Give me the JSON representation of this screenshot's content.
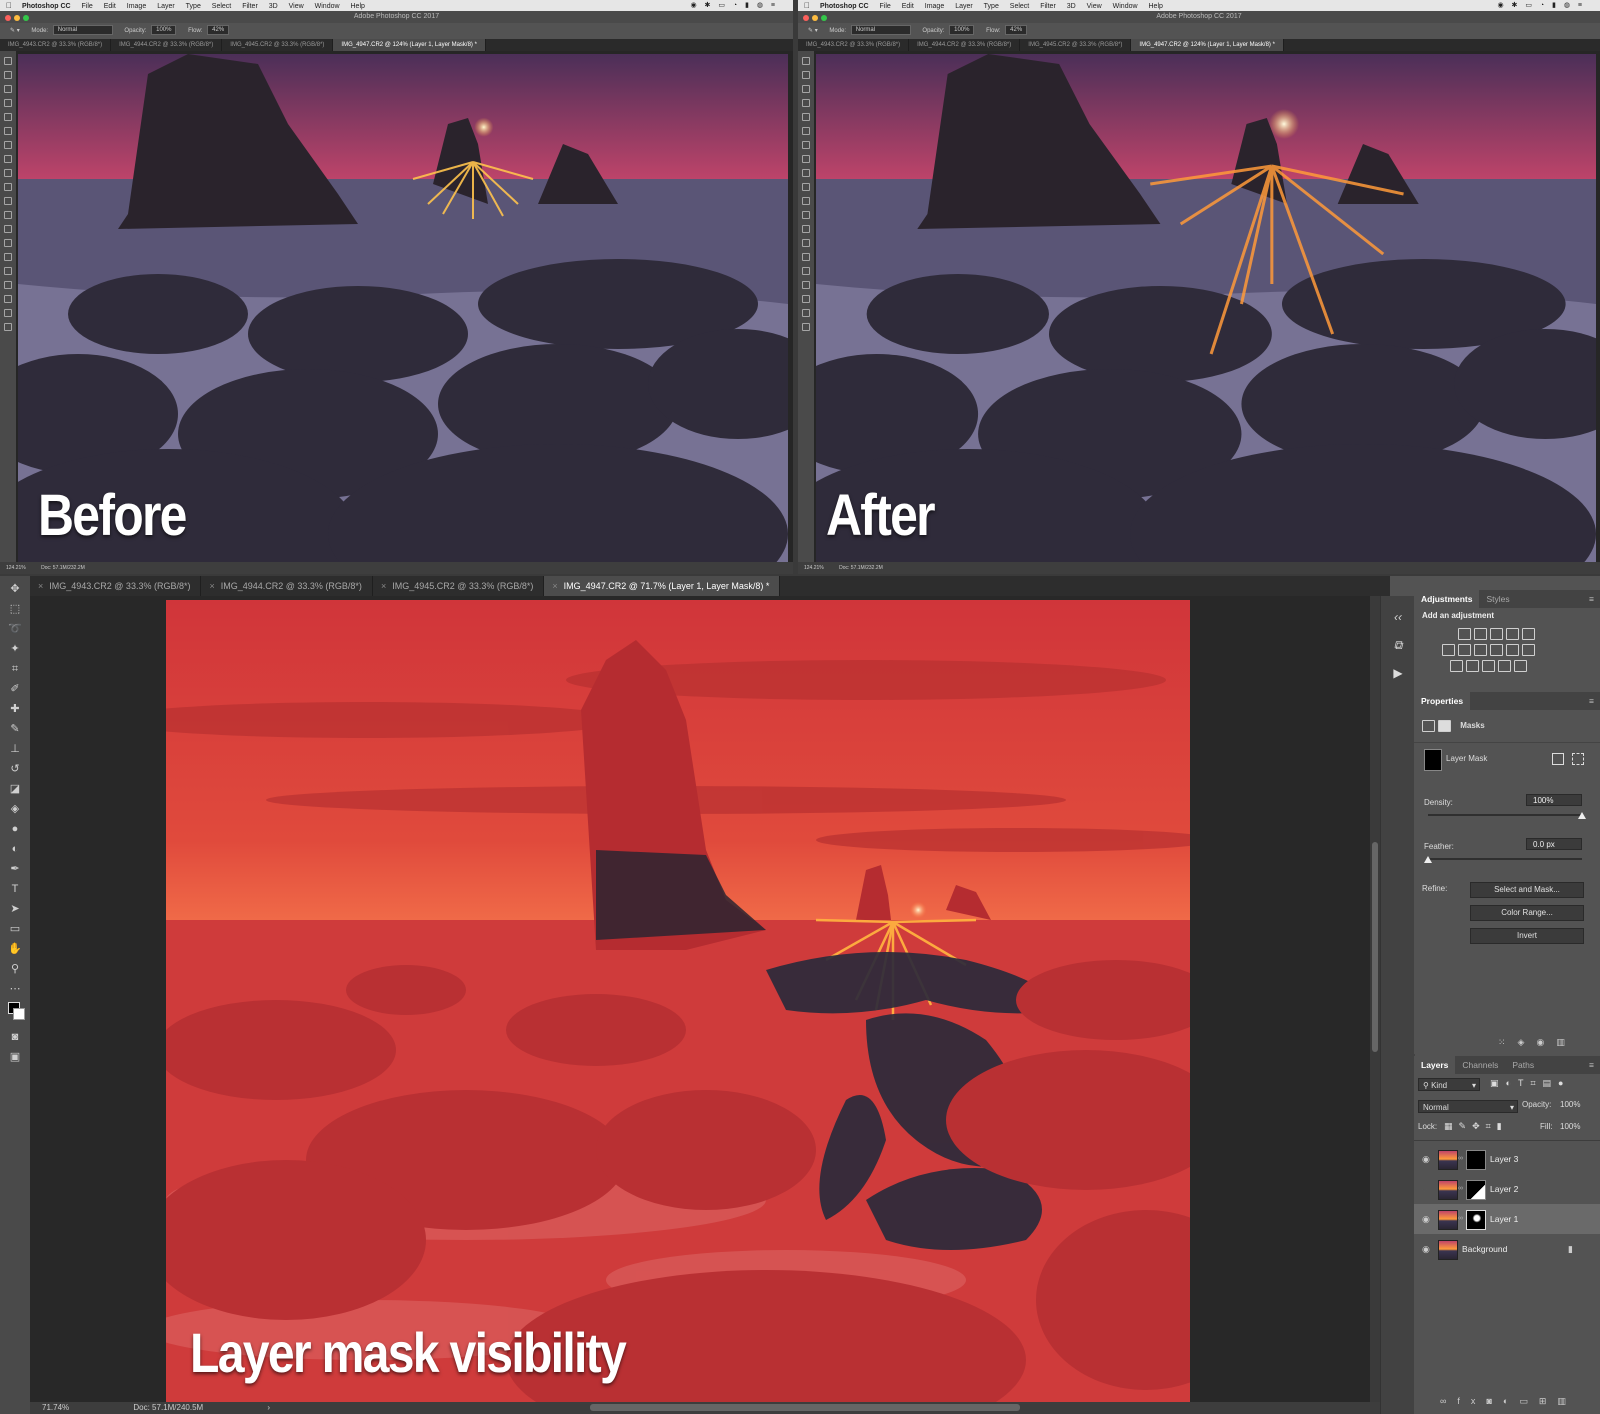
{
  "top_windows": [
    {
      "menubar": {
        "app_name": "Photoshop CC",
        "items": [
          "File",
          "Edit",
          "Image",
          "Layer",
          "Type",
          "Select",
          "Filter",
          "3D",
          "View",
          "Window",
          "Help"
        ]
      },
      "window_title": "Adobe Photoshop CC 2017",
      "options": {
        "mode_label": "Mode:",
        "mode_value": "Normal",
        "opacity_label": "Opacity:",
        "opacity_value": "100%",
        "flow_label": "Flow:",
        "flow_value": "42%"
      },
      "tabs": [
        "IMG_4943.CR2 @ 33.3% (RGB/8*)",
        "IMG_4944.CR2 @ 33.3% (RGB/8*)",
        "IMG_4945.CR2 @ 33.3% (RGB/8*)",
        "IMG_4947.CR2 @ 124% (Layer 1, Layer Mask/8) *"
      ],
      "active_tab": 3,
      "status": {
        "zoom": "124.21%",
        "doc": "Doc: 57.1M/232.2M"
      },
      "caption": "Before"
    },
    {
      "menubar": {
        "app_name": "Photoshop CC",
        "items": [
          "File",
          "Edit",
          "Image",
          "Layer",
          "Type",
          "Select",
          "Filter",
          "3D",
          "View",
          "Window",
          "Help"
        ]
      },
      "window_title": "Adobe Photoshop CC 2017",
      "options": {
        "mode_label": "Mode:",
        "mode_value": "Normal",
        "opacity_label": "Opacity:",
        "opacity_value": "100%",
        "flow_label": "Flow:",
        "flow_value": "42%"
      },
      "tabs": [
        "IMG_4943.CR2 @ 33.3% (RGB/8*)",
        "IMG_4944.CR2 @ 33.3% (RGB/8*)",
        "IMG_4945.CR2 @ 33.3% (RGB/8*)",
        "IMG_4947.CR2 @ 124% (Layer 1, Layer Mask/8) *"
      ],
      "active_tab": 3,
      "status": {
        "zoom": "124.21%",
        "doc": "Doc: 57.1M/232.2M"
      },
      "caption": "After"
    }
  ],
  "bottom_window": {
    "tabs": [
      "IMG_4943.CR2 @ 33.3% (RGB/8*)",
      "IMG_4944.CR2 @ 33.3% (RGB/8*)",
      "IMG_4945.CR2 @ 33.3% (RGB/8*)",
      "IMG_4947.CR2 @ 71.7% (Layer 1, Layer Mask/8) *"
    ],
    "active_tab": 3,
    "caption": "Layer mask visibility",
    "status": {
      "zoom": "71.74%",
      "doc": "Doc: 57.1M/240.5M"
    }
  },
  "adjustments_panel": {
    "tabs": [
      "Adjustments",
      "Styles"
    ],
    "active_tab": 0,
    "subtitle": "Add an adjustment"
  },
  "properties_panel": {
    "title": "Properties",
    "section": "Masks",
    "mask_name": "Layer Mask",
    "density_label": "Density:",
    "density_value": "100%",
    "feather_label": "Feather:",
    "feather_value": "0.0 px",
    "refine_label": "Refine:",
    "buttons": [
      "Select and Mask...",
      "Color Range...",
      "Invert"
    ]
  },
  "layers_panel": {
    "tabs": [
      "Layers",
      "Channels",
      "Paths"
    ],
    "active_tab": 0,
    "filter_kind": "Kind",
    "blend_mode": "Normal",
    "opacity_label": "Opacity:",
    "opacity_value": "100%",
    "lock_label": "Lock:",
    "fill_label": "Fill:",
    "fill_value": "100%",
    "layers": [
      {
        "name": "Layer 3",
        "visible": true,
        "selected": false
      },
      {
        "name": "Layer 2",
        "visible": false,
        "selected": false
      },
      {
        "name": "Layer 1",
        "visible": true,
        "selected": true
      },
      {
        "name": "Background",
        "visible": true,
        "selected": false,
        "locked": true
      }
    ]
  },
  "colors": {
    "mask_overlay": "#d83a33",
    "ui_dark": "#262626",
    "ui_panel": "#535353"
  }
}
